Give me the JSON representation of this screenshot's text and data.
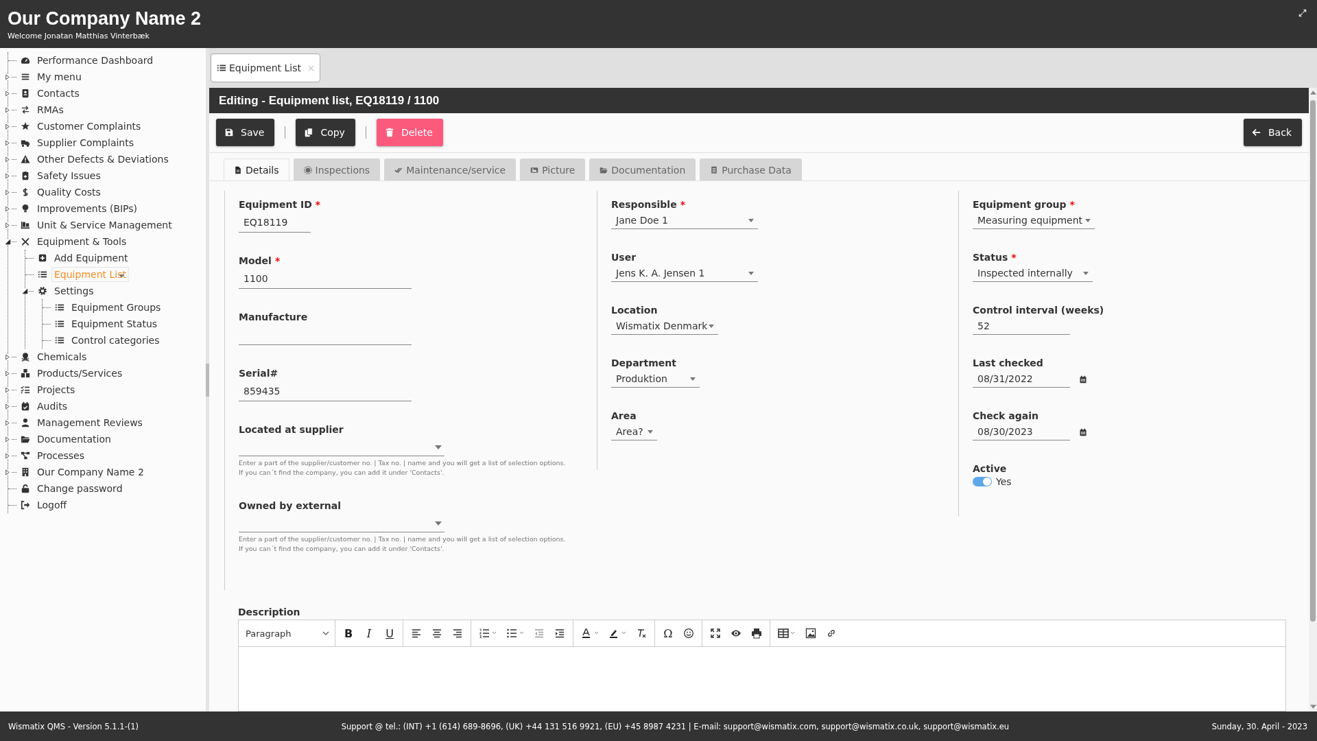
{
  "header": {
    "company": "Our Company Name 2",
    "welcome": "Welcome Jonatan Matthias Vinterbæk"
  },
  "sidebar": {
    "items": [
      {
        "label": "Performance Dashboard",
        "selected": false
      },
      {
        "label": "My menu",
        "expanded": false,
        "selected": false
      },
      {
        "label": "Contacts",
        "expanded": false,
        "selected": false
      },
      {
        "label": "RMAs",
        "expanded": false,
        "selected": false
      },
      {
        "label": "Customer Complaints",
        "expanded": false,
        "selected": false
      },
      {
        "label": "Supplier Complaints",
        "expanded": false,
        "selected": false
      },
      {
        "label": "Other Defects & Deviations",
        "expanded": false,
        "selected": false
      },
      {
        "label": "Safety Issues",
        "expanded": false,
        "selected": false
      },
      {
        "label": "Quality Costs",
        "expanded": false,
        "selected": false
      },
      {
        "label": "Improvements (BIPs)",
        "expanded": false,
        "selected": false
      },
      {
        "label": "Unit & Service Management",
        "expanded": false,
        "selected": false
      },
      {
        "label": "Equipment & Tools",
        "expanded": true,
        "selected": false,
        "children": [
          {
            "label": "Add Equipment",
            "selected": false
          },
          {
            "label": "Equipment List",
            "selected": true
          },
          {
            "label": "Settings",
            "expanded": true,
            "selected": false,
            "children": [
              {
                "label": "Equipment Groups",
                "selected": false
              },
              {
                "label": "Equipment Status",
                "selected": false
              },
              {
                "label": "Control categories",
                "selected": false
              }
            ]
          }
        ]
      },
      {
        "label": "Chemicals",
        "expanded": false,
        "selected": false
      },
      {
        "label": "Products/Services",
        "expanded": false,
        "selected": false
      },
      {
        "label": "Projects",
        "expanded": false,
        "selected": false
      },
      {
        "label": "Audits",
        "expanded": false,
        "selected": false
      },
      {
        "label": "Management Reviews",
        "expanded": false,
        "selected": false
      },
      {
        "label": "Documentation",
        "expanded": false,
        "selected": false
      },
      {
        "label": "Processes",
        "expanded": false,
        "selected": false
      },
      {
        "label": "Our Company Name 2",
        "expanded": false,
        "selected": false
      },
      {
        "label": "Change password",
        "selected": false
      },
      {
        "label": "Logoff",
        "selected": false
      }
    ]
  },
  "open_tabs": [
    {
      "label": "Equipment List",
      "selected": true
    }
  ],
  "page_title": "Editing - Equipment list, EQ18119 / 1100",
  "actions": [
    {
      "label": "Save",
      "kind": "save"
    },
    {
      "label": "Copy",
      "kind": "copy"
    },
    {
      "label": "Delete",
      "kind": "delete"
    }
  ],
  "back": "Back",
  "tabs": [
    {
      "label": "Details",
      "selected": true
    },
    {
      "label": "Inspections",
      "selected": false
    },
    {
      "label": "Maintenance/service",
      "selected": false
    },
    {
      "label": "Picture",
      "selected": false
    },
    {
      "label": "Documentation",
      "selected": false
    },
    {
      "label": "Purchase Data",
      "selected": false
    }
  ],
  "columns": [
    [
      {
        "label": "Equipment ID",
        "required_mark": "*",
        "kind": "text",
        "value": "EQ18119"
      },
      {
        "label": "Model",
        "required_mark": "*",
        "kind": "text",
        "value": "1100"
      },
      {
        "label": "Manufacture",
        "kind": "text"
      },
      {
        "label": "Serial#",
        "kind": "text",
        "value": "859435"
      },
      {
        "label": "Located at supplier",
        "kind": "lookup",
        "hint": [
          "Enter a part of the supplier/customer no. | Tax no. | name and you will get a list of selection options.",
          "If you can´t find the company, you can add it under 'Contacts'."
        ]
      },
      {
        "label": "Owned by external",
        "kind": "lookup",
        "hint": [
          "Enter a part of the supplier/customer no. | Tax no. | name and you will get a list of selection options.",
          "If you can´t find the company, you can add it under 'Contacts'."
        ]
      }
    ],
    [
      {
        "label": "Responsible",
        "required_mark": "*",
        "kind": "select",
        "value": "Jane Doe 1"
      },
      {
        "label": "User",
        "kind": "select",
        "value": "Jens K. A. Jensen 1"
      },
      {
        "label": "Location",
        "kind": "select",
        "value": "Wismatix Denmark"
      },
      {
        "label": "Department",
        "kind": "select",
        "value": "Produktion"
      },
      {
        "label": "Area",
        "kind": "select",
        "value": "Area?"
      }
    ],
    [
      {
        "label": "Equipment group",
        "required_mark": "*",
        "kind": "select",
        "value": "Measuring equipment"
      },
      {
        "label": "Status",
        "required_mark": "*",
        "kind": "select",
        "value": "Inspected internally"
      },
      {
        "label": "Control interval (weeks)",
        "kind": "text",
        "value": "52"
      },
      {
        "label": "Last checked",
        "kind": "date",
        "value": "08/31/2022"
      },
      {
        "label": "Check again",
        "kind": "date",
        "value": "08/30/2023"
      },
      {
        "label": "Active",
        "kind": "toggle",
        "on": true,
        "value": "Yes"
      }
    ]
  ],
  "description": {
    "label": "Description",
    "block_format": "Paragraph",
    "bold": "B",
    "italic": "I",
    "underline": "U",
    "special_char": "Ω"
  },
  "footer": {
    "version": "Wismatix QMS - Version 5.1.1-(1)",
    "support": "Support @ tel.: (INT) +1 (614) 689-8696, (UK) +44 131 516 9921, (EU) +45 8987 4231 | E-mail: support@wismatix.com, support@wismatix.co.uk, support@wismatix.eu",
    "date": "Sunday, 30. April - 2023"
  }
}
